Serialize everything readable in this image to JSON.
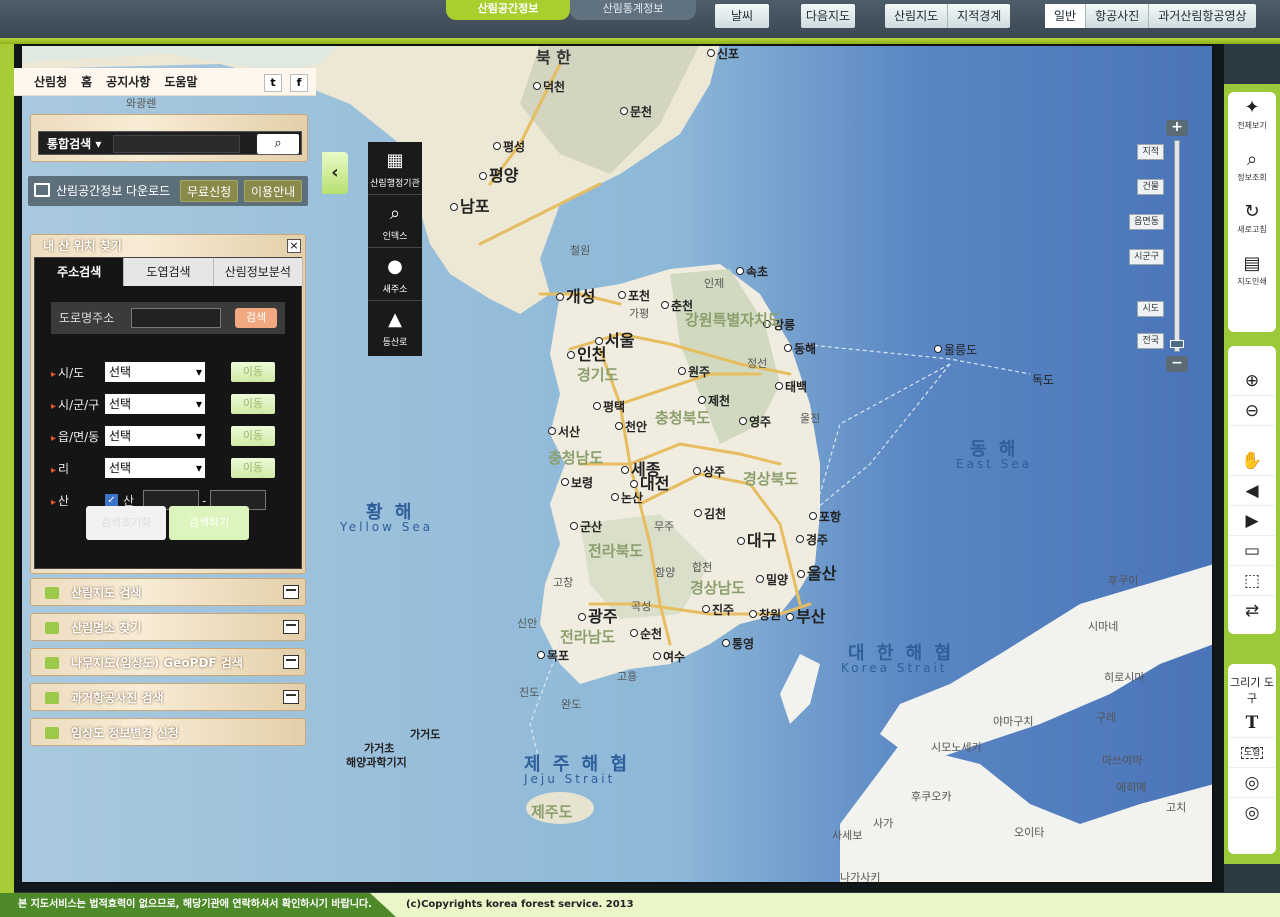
{
  "top_tabs": {
    "active": "산림공간정보",
    "inactive": "산림통계정보"
  },
  "top_buttons": {
    "weather": "날씨",
    "daum_map": "다음지도"
  },
  "layer_group": [
    "산림지도",
    "지적경계"
  ],
  "basemap_group": [
    "일반",
    "항공사진",
    "과거산림항공영상"
  ],
  "link_bar": {
    "items": [
      "산림청",
      "홈",
      "공지사항",
      "도움말"
    ],
    "twitter": "t",
    "facebook": "f"
  },
  "search": {
    "type": "통합검색",
    "placeholder": ""
  },
  "download": {
    "label": "산림공간정보 다운로드",
    "free_request": "무료신청",
    "usage_guide": "이용안내"
  },
  "find_panel": {
    "title": "내 산 위치 찾기",
    "tabs": [
      "주소검색",
      "도엽검색",
      "산림정보분석"
    ],
    "road_label": "도로명주소",
    "road_button": "검색",
    "rows": [
      {
        "label": "시/도",
        "value": "선택",
        "go": "이동"
      },
      {
        "label": "시/군/구",
        "value": "선택",
        "go": "이동"
      },
      {
        "label": "읍/면/동",
        "value": "선택",
        "go": "이동"
      },
      {
        "label": "리",
        "value": "선택",
        "go": "이동"
      }
    ],
    "san_label": "산",
    "san_checkbox": "산",
    "san_dash": "-",
    "reset_button": "검색초기화",
    "search_button": "검색하기"
  },
  "accordion": [
    "산림지도 검색",
    "산림명소 찾기",
    "나무지도(임상도) GeoPDF 검색",
    "과거항공사진 검색",
    "임상도 정보변경 신청"
  ],
  "quick_nav": [
    "산림행정기관",
    "인덱스",
    "새주소",
    "등산로"
  ],
  "zoom_levels": [
    "지적",
    "건물",
    "읍면동",
    "시군구",
    "시도",
    "전국"
  ],
  "zoom_plus": "+",
  "zoom_minus": "−",
  "right_tools": {
    "group1": [
      "전체보기",
      "정보조회",
      "새로고침",
      "지도인쇄"
    ],
    "draw_label": "그리기 도구",
    "draw_text": "T",
    "draw_shape": "도형"
  },
  "map_labels": {
    "cities": [
      "신포",
      "덕천",
      "문천",
      "평성",
      "평양",
      "남포",
      "개성",
      "포천",
      "춘천",
      "속초",
      "강릉",
      "동해",
      "인천",
      "서울",
      "원주",
      "태백",
      "평택",
      "제천",
      "영주",
      "서산",
      "천안",
      "세종",
      "상주",
      "대전",
      "보령",
      "논산",
      "김천",
      "포항",
      "군산",
      "대구",
      "경주",
      "울산",
      "밀양",
      "광주",
      "진주",
      "창원",
      "부산",
      "순천",
      "통영",
      "목포",
      "여수"
    ],
    "faded": [
      "와광렌",
      "철원",
      "인제",
      "가평",
      "정선",
      "울진",
      "무주",
      "합천",
      "함양",
      "고창",
      "곡성",
      "신안",
      "고흥",
      "진도",
      "완도",
      "후쿠이",
      "시마네",
      "히로시마",
      "야마구치",
      "구레",
      "시모노세키",
      "마쓰야마",
      "에히메",
      "후쿠오카",
      "고치",
      "사가",
      "사세보",
      "오이타",
      "나가사키"
    ],
    "provinces": [
      "강원특별자치도",
      "경기도",
      "충청북도",
      "충청남도",
      "경상북도",
      "전라북도",
      "경상남도",
      "전라남도",
      "제주도"
    ],
    "islands": [
      "울릉도",
      "독도"
    ],
    "seas": [
      {
        "ko": "황 해",
        "en": "Yellow Sea"
      },
      {
        "ko": "동 해",
        "en": "East Sea"
      },
      {
        "ko": "대 한 해 협",
        "en": "Korea Strait"
      },
      {
        "ko": "제 주 해 협",
        "en": "Jeju Strait"
      }
    ],
    "north": "북 한",
    "misc": [
      "가거도",
      "가거초",
      "해양과학기지"
    ]
  },
  "footer": {
    "notice": "본 지도서비스는 법적효력이 없으므로, 해당기관에 연락하셔서 확인하시기 바랍니다.",
    "copyright": "(c)Copyrights korea forest service. 2013"
  },
  "colors": {
    "accent_green": "#9cc93a",
    "sea": "#5b8ec9",
    "land": "#f0ede2"
  }
}
